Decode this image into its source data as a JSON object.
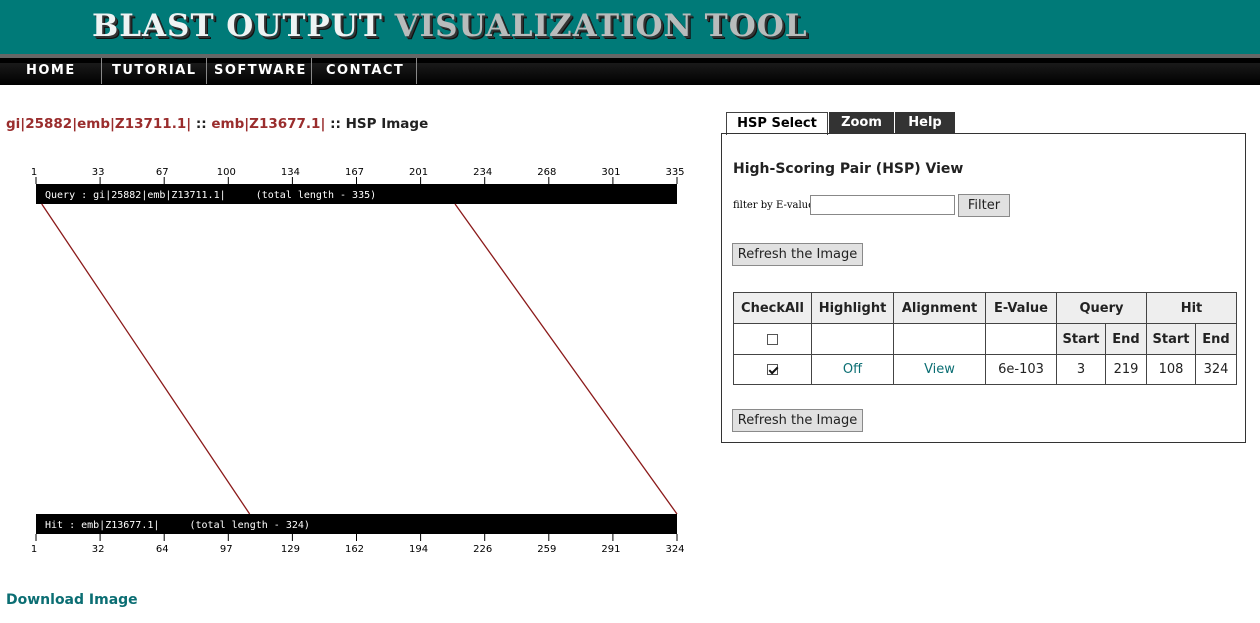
{
  "site": {
    "title_bright": "BLAST OUTPUT ",
    "title_dim": "VISUALIZATION TOOL"
  },
  "nav": [
    {
      "label": "HOME"
    },
    {
      "label": "TUTORIAL"
    },
    {
      "label": "SOFTWARE"
    },
    {
      "label": "CONTACT"
    }
  ],
  "image_title": {
    "query": "gi|25882|emb|Z13711.1|",
    "sep1": " :: ",
    "hit": "emb|Z13677.1|",
    "sep2": " :: ",
    "suffix": "HSP Image"
  },
  "visualization": {
    "query_ticks": [
      "1",
      "33",
      "67",
      "100",
      "134",
      "167",
      "201",
      "234",
      "268",
      "301",
      "335"
    ],
    "hit_ticks": [
      "1",
      "32",
      "64",
      "97",
      "129",
      "162",
      "194",
      "226",
      "259",
      "291",
      "324"
    ],
    "query_label": "Query : gi|25882|emb|Z13711.1|     (total length - 335)",
    "hit_label": "Hit : emb|Z13677.1|     (total length - 324)",
    "query_length": 335,
    "hit_length": 324,
    "hsps": [
      {
        "query_start": 3,
        "query_end": 219,
        "hit_start": 108,
        "hit_end": 324
      }
    ],
    "line_color": "#8b1a1a"
  },
  "download_label": "Download Image",
  "tabs": [
    {
      "label": "HSP Select",
      "active": true
    },
    {
      "label": "Zoom",
      "active": false
    },
    {
      "label": "Help",
      "active": false
    }
  ],
  "panel": {
    "title": "High-Scoring Pair (HSP) View",
    "filter_label": "filter by E-value:",
    "filter_value": "",
    "filter_button": "Filter",
    "refresh_button": "Refresh the Image"
  },
  "table": {
    "headers": {
      "checkall": "CheckAll",
      "highlight": "Highlight",
      "alignment": "Alignment",
      "evalue": "E-Value",
      "query": "Query",
      "hit": "Hit",
      "start": "Start",
      "end": "End"
    },
    "checkall_checked": false,
    "rows": [
      {
        "checked": true,
        "highlight": "Off",
        "alignment": "View",
        "evalue": "6e-103",
        "query_start": "3",
        "query_end": "219",
        "hit_start": "108",
        "hit_end": "324"
      }
    ]
  },
  "colors": {
    "header_bg": "#007a78",
    "link": "#0b6e73",
    "title_red": "#9a2d2d"
  }
}
